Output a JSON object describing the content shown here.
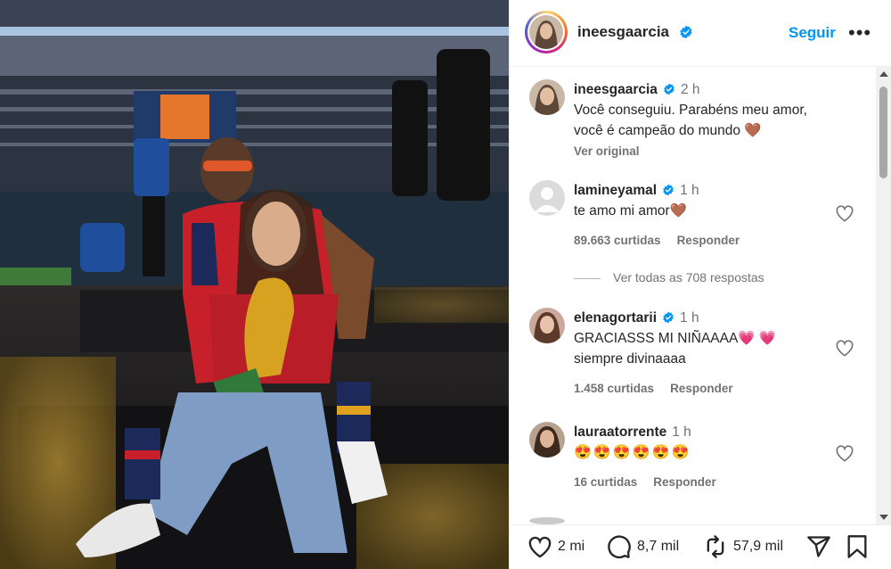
{
  "post": {
    "author": "ineesgaarcia",
    "follow_label": "Seguir",
    "more_label": "•••"
  },
  "caption": {
    "user": "ineesgaarcia",
    "time": "2 h",
    "text": "Você conseguiu. Parabéns meu amor, você é campeão do mundo 🤎",
    "see_original": "Ver original"
  },
  "comments": [
    {
      "user": "lamineyamal",
      "verified": true,
      "time": "1 h",
      "text": "te amo mi amor🤎",
      "likes": "89.663 curtidas",
      "reply_label": "Responder",
      "view_replies": "Ver todas as 708 respostas"
    },
    {
      "user": "elenagortarii",
      "verified": true,
      "time": "1 h",
      "text": "GRACIASSS MI NIÑAAAA💗 💗 siempre divinaaaa",
      "likes": "1.458 curtidas",
      "reply_label": "Responder"
    },
    {
      "user": "lauraatorrente",
      "verified": false,
      "time": "1 h",
      "text": "😍😍😍😍😍😍",
      "likes": "16 curtidas",
      "reply_label": "Responder"
    }
  ],
  "actions": {
    "likes_count": "2 mi",
    "comments_count": "8,7 mil",
    "reposts_count": "57,9 mil"
  },
  "colors": {
    "link_blue": "#0095f6",
    "verified_blue": "#0095f6",
    "muted": "#737373"
  },
  "icons": [
    "verified-badge-icon",
    "more-options-icon",
    "like-heart-icon",
    "comment-icon",
    "repost-icon",
    "share-icon",
    "save-bookmark-icon"
  ]
}
